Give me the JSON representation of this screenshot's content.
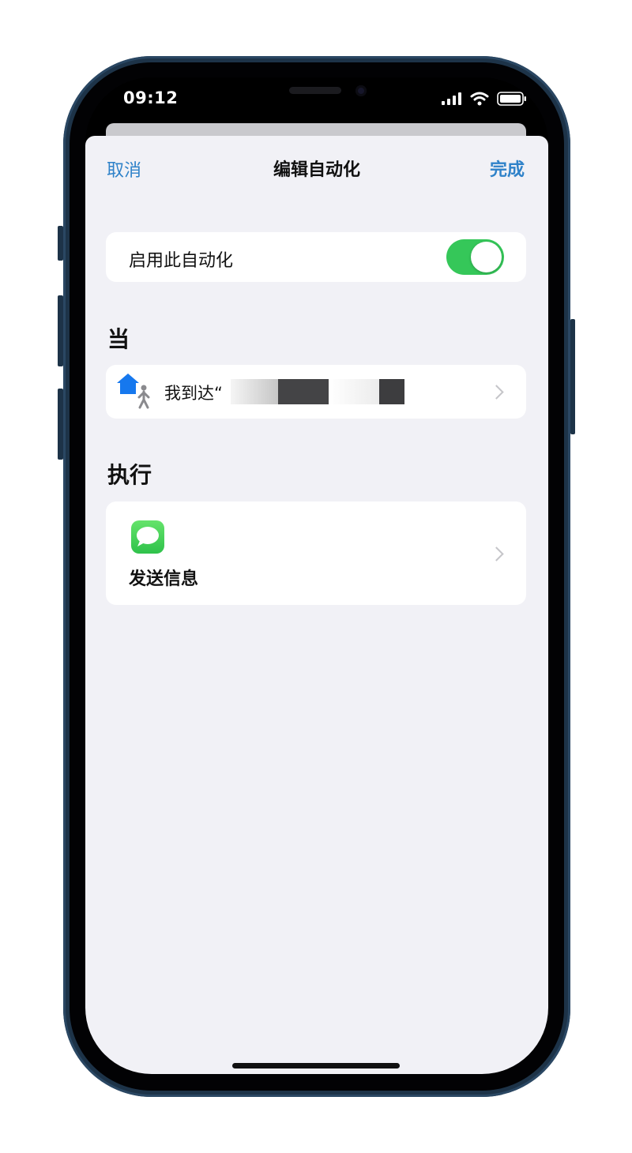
{
  "status_bar": {
    "time": "09:12"
  },
  "nav": {
    "cancel": "取消",
    "title": "编辑自动化",
    "done": "完成"
  },
  "enable": {
    "label": "启用此自动化",
    "on": true
  },
  "when": {
    "section_title": "当",
    "trigger_text": "我到达“"
  },
  "do": {
    "section_title": "执行",
    "action_label": "发送信息"
  },
  "colors": {
    "accent": "#2f82c9",
    "toggle_on": "#35c759",
    "background": "#f1f1f6"
  },
  "icons": [
    "location-home-icon",
    "messages-icon",
    "chevron-right-icon",
    "signal-icon",
    "wifi-icon",
    "battery-icon"
  ]
}
